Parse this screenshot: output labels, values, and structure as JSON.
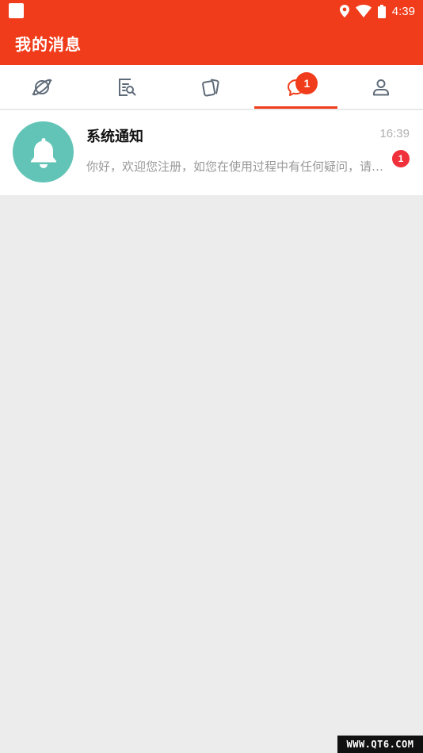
{
  "status_bar": {
    "time": "4:39",
    "icons": [
      "app-square-icon",
      "location-icon",
      "wifi-icon",
      "battery-icon"
    ]
  },
  "app_bar": {
    "title": "我的消息"
  },
  "tabs": [
    {
      "name": "planet",
      "icon": "planet-icon",
      "active": false
    },
    {
      "name": "search-doc",
      "icon": "document-search-icon",
      "active": false
    },
    {
      "name": "cards",
      "icon": "cards-icon",
      "active": false
    },
    {
      "name": "messages",
      "icon": "chat-bubble-icon",
      "active": true,
      "badge": "1"
    },
    {
      "name": "profile",
      "icon": "user-icon",
      "active": false
    }
  ],
  "messages": [
    {
      "title": "系统通知",
      "time": "16:39",
      "preview": "你好，欢迎您注册，如您在使用过程中有任何疑问，请随时联系我们",
      "badge": "1",
      "avatar_icon": "bell-icon"
    }
  ],
  "watermark": "WWW.QT6.COM",
  "colors": {
    "primary": "#f03c1a",
    "avatar": "#62c4b7",
    "badge": "#f0303a",
    "background": "#ececec",
    "icon_gray": "#5f6b78"
  }
}
